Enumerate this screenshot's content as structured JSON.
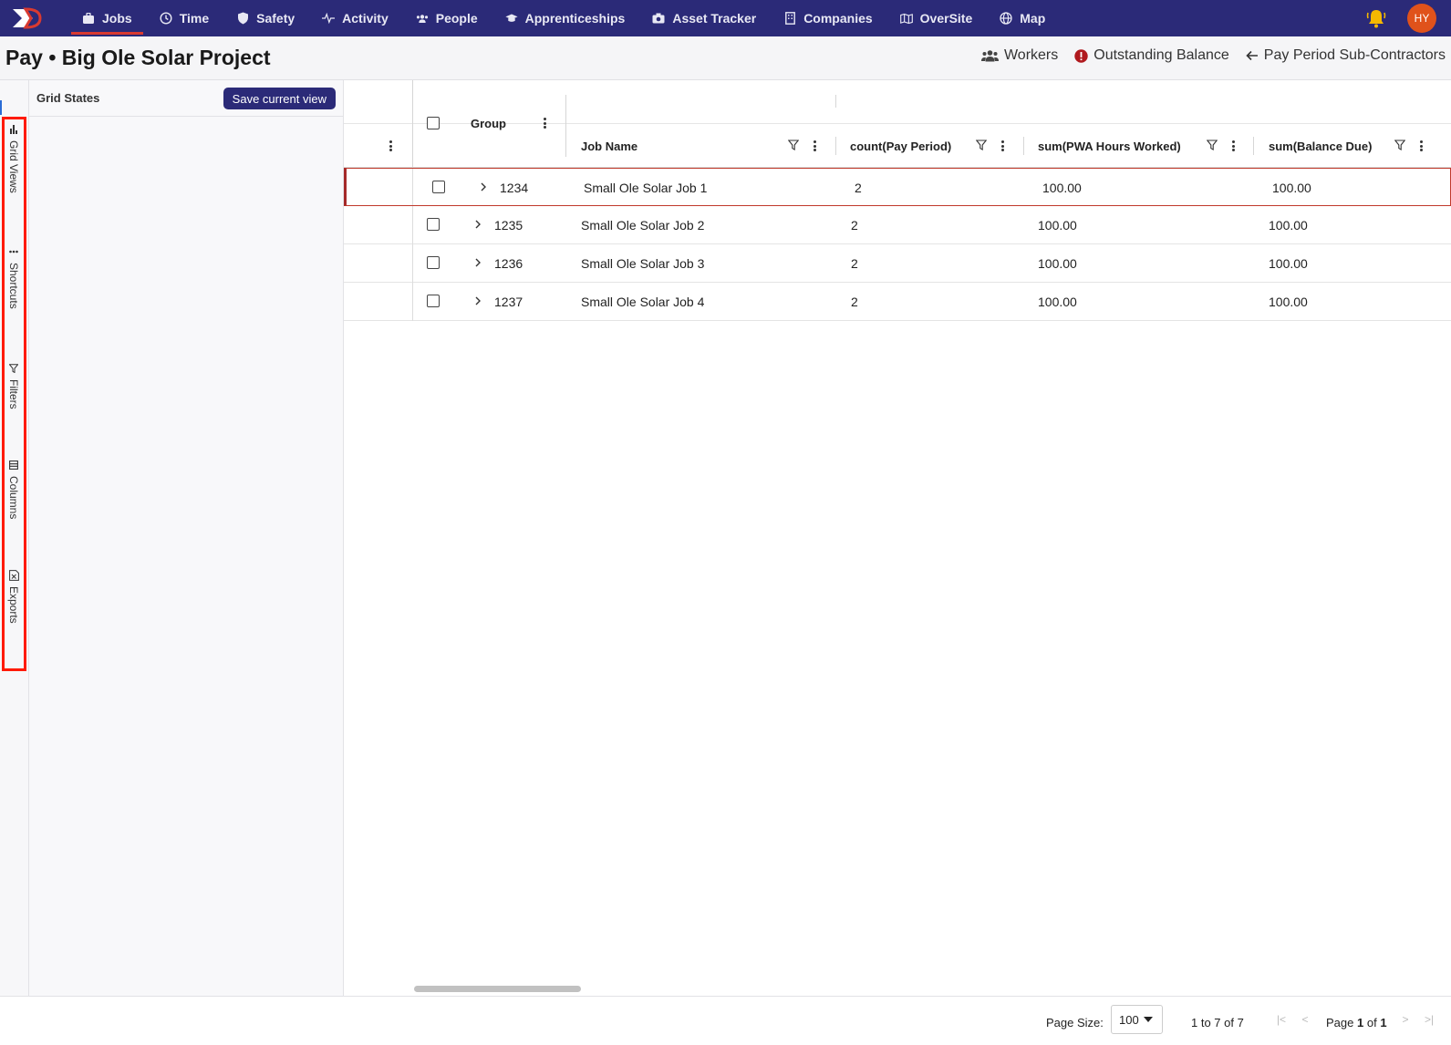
{
  "nav": {
    "items": [
      {
        "label": "Jobs",
        "icon": "briefcase-icon",
        "active": true
      },
      {
        "label": "Time",
        "icon": "clock-icon"
      },
      {
        "label": "Safety",
        "icon": "shield-icon"
      },
      {
        "label": "Activity",
        "icon": "pulse-icon"
      },
      {
        "label": "People",
        "icon": "people-icon"
      },
      {
        "label": "Apprenticeships",
        "icon": "graduation-cap-icon"
      },
      {
        "label": "Asset Tracker",
        "icon": "camera-icon"
      },
      {
        "label": "Companies",
        "icon": "building-icon"
      },
      {
        "label": "OverSite",
        "icon": "map-book-icon"
      },
      {
        "label": "Map",
        "icon": "globe-icon"
      }
    ],
    "avatar_initials": "HY",
    "colors": {
      "bar": "#2b2a78",
      "active_underline": "#d93a30",
      "bell": "#f5b800",
      "avatar": "#e0521b"
    }
  },
  "header": {
    "title": "Pay • Big Ole Solar Project",
    "actions": [
      {
        "label": "Workers",
        "icon": "users-icon"
      },
      {
        "label": "Outstanding Balance",
        "icon": "alert-circle-icon"
      },
      {
        "label": "Pay Period Sub-Contractors",
        "icon": "arrow-left-icon"
      }
    ]
  },
  "side_tabs": [
    {
      "label": "Grid Views",
      "icon": "bar-chart-icon"
    },
    {
      "label": "Shortcuts",
      "icon": "more-horizontal-icon"
    },
    {
      "label": "Filters",
      "icon": "filter-icon"
    },
    {
      "label": "Columns",
      "icon": "columns-icon"
    },
    {
      "label": "Exports",
      "icon": "excel-file-icon"
    }
  ],
  "grid_states": {
    "title": "Grid States",
    "save_button": "Save current view"
  },
  "grid": {
    "group_header": "Group",
    "columns": [
      "Job Name",
      "count(Pay Period)",
      "sum(PWA Hours Worked)",
      "sum(Balance Due)"
    ],
    "rows": [
      {
        "group": "1234",
        "job_name": "Small Ole Solar Job 1",
        "count": "2",
        "hours": "100.00",
        "balance": "100.00"
      },
      {
        "group": "1235",
        "job_name": "Small Ole Solar Job 2",
        "count": "2",
        "hours": "100.00",
        "balance": "100.00"
      },
      {
        "group": "1236",
        "job_name": "Small Ole Solar Job 3",
        "count": "2",
        "hours": "100.00",
        "balance": "100.00"
      },
      {
        "group": "1237",
        "job_name": "Small Ole Solar Job 4",
        "count": "2",
        "hours": "100.00",
        "balance": "100.00"
      }
    ]
  },
  "footer": {
    "page_size_label": "Page Size:",
    "page_size": "100",
    "range": "1 to 7 of 7",
    "page_prefix": "Page",
    "page_current": "1",
    "page_of": "of",
    "page_total": "1"
  }
}
